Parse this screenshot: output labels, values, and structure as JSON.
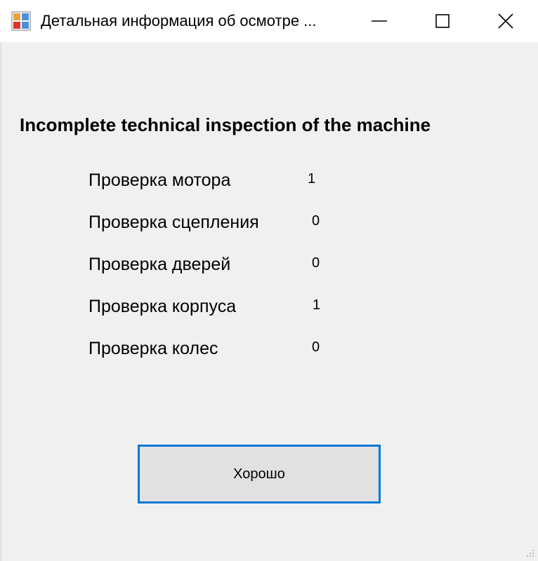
{
  "window": {
    "title": "Детальная информация об осмотре ...",
    "controls": {
      "minimize": "minimize-icon",
      "maximize": "maximize-icon",
      "close": "close-icon"
    }
  },
  "heading": "Incomplete technical inspection of the machine",
  "checks": [
    {
      "label": "Проверка мотора",
      "value": "1"
    },
    {
      "label": "Проверка сцепления",
      "value": "0"
    },
    {
      "label": "Проверка дверей",
      "value": "0"
    },
    {
      "label": "Проверка корпуса",
      "value": "1"
    },
    {
      "label": "Проверка колес",
      "value": "0"
    }
  ],
  "ok_button": {
    "label": "Хорошо"
  },
  "colors": {
    "background": "#f0f0f0",
    "titlebar": "#ffffff",
    "button_face": "#e1e1e1",
    "focus_border": "#0078d7"
  }
}
